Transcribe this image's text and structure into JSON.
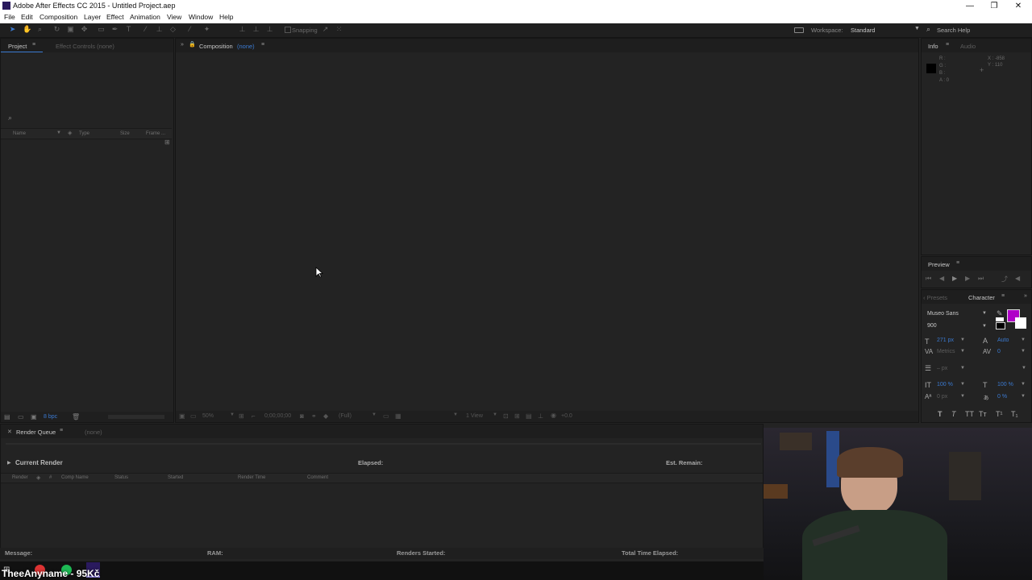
{
  "window": {
    "title": "Adobe After Effects CC 2015 - Untitled Project.aep",
    "minimize": "—",
    "restore": "❐",
    "close": "✕"
  },
  "menu": [
    "File",
    "Edit",
    "Composition",
    "Layer",
    "Effect",
    "Animation",
    "View",
    "Window",
    "Help"
  ],
  "toolbar": {
    "snapping_label": "Snapping",
    "workspace_label": "Workspace:",
    "workspace_value": "Standard",
    "search_placeholder": "Search Help"
  },
  "project_panel": {
    "tab_project": "Project",
    "tab_effect_controls": "Effect Controls (none)",
    "columns": [
      "Name",
      "Type",
      "Size",
      "Frame ..."
    ],
    "bpc": "8 bpc"
  },
  "composition_panel": {
    "tab_label": "Composition",
    "tab_value": "(none)",
    "zoom": "50%",
    "timecode": "0;00;00;00",
    "resolution": "(Full)",
    "views": "1 View",
    "exposure": "+0.0"
  },
  "info_panel": {
    "tab_info": "Info",
    "tab_audio": "Audio",
    "r": "R :",
    "g": "G :",
    "b": "B :",
    "a": "A : 0",
    "x": "X : -858",
    "y": "Y : 110"
  },
  "preview_panel": {
    "tab": "Preview"
  },
  "character_panel": {
    "tab_presets": "‹ Presets",
    "tab_character": "Character",
    "font_family": "Museo Sans",
    "font_style": "900",
    "font_size": "271 px",
    "leading": "Auto",
    "kerning": "Metrics",
    "tracking": "0",
    "stroke_width": "– px",
    "vert_scale": "100 %",
    "horiz_scale": "100 %",
    "baseline_shift": "0 px",
    "tsume": "0 %",
    "fill_color": "#b000c8",
    "style_buttons": [
      "T",
      "T",
      "TT",
      "Tᴛ",
      "T¹",
      "T₁"
    ]
  },
  "render_queue": {
    "tab_label": "Render Queue",
    "tab_value": "(none)",
    "current_render": "Current Render",
    "elapsed": "Elapsed:",
    "est_remain": "Est. Remain:",
    "columns": [
      "Render",
      "#",
      "Comp Name",
      "Status",
      "Started",
      "Render Time",
      "Comment"
    ],
    "message": "Message:",
    "ram": "RAM:",
    "renders_started": "Renders Started:",
    "total_time": "Total Time Elapsed:"
  },
  "overlay": {
    "streamer_text": "TheeAnyname - 95Kč"
  }
}
